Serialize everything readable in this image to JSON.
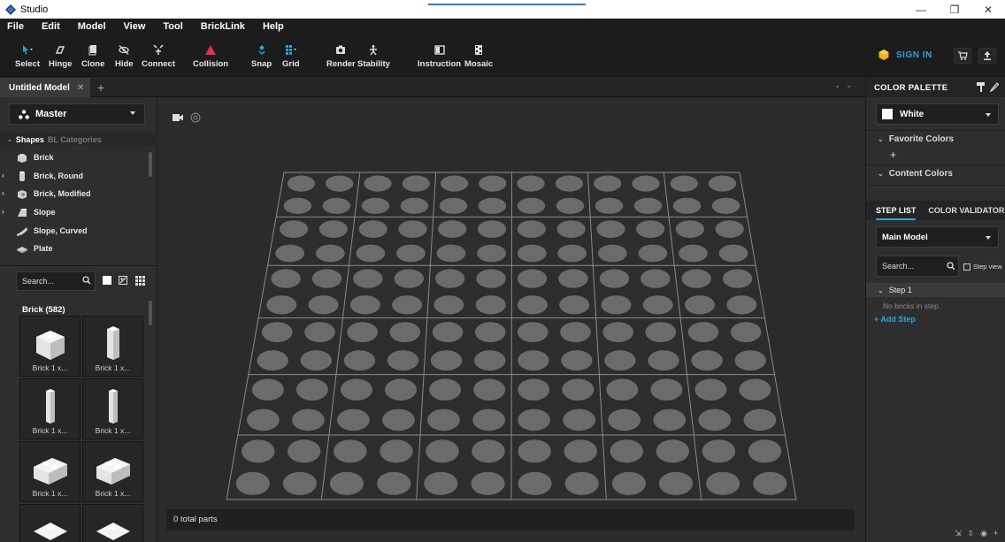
{
  "window": {
    "title": "Studio",
    "controls": [
      "—",
      "❐",
      "✕"
    ]
  },
  "menu": [
    "File",
    "Edit",
    "Model",
    "View",
    "Tool",
    "BrickLink",
    "Help"
  ],
  "toolbar": {
    "select": "Select",
    "hinge": "Hinge",
    "clone": "Clone",
    "hide": "Hide",
    "connect": "Connect",
    "collision": "Collision",
    "snap": "Snap",
    "grid": "Grid",
    "render": "Render",
    "stability": "Stability",
    "instruction": "Instruction",
    "mosaic": "Mosaic",
    "sign_in": "SIGN IN"
  },
  "tabs": {
    "model_tab": "Untitled Model",
    "close": "✕",
    "add": "+",
    "nav": "◂ ▸"
  },
  "left": {
    "palette_select": "Master",
    "shapes_tab": "Shapes",
    "categories_tab": "BL Categories",
    "categories": [
      "Brick",
      "Brick, Round",
      "Brick, Modified",
      "Slope",
      "Slope, Curved",
      "Plate"
    ],
    "search_placeholder": "Search...",
    "brick_count": "Brick (582)",
    "parts": [
      "Brick 1 x...",
      "Brick 1 x...",
      "Brick 1 x...",
      "Brick 1 x...",
      "Brick 1 x...",
      "Brick 1 x..."
    ]
  },
  "viewport": {
    "status": "0 total parts",
    "baseplate_cells": [
      6,
      6
    ],
    "studs_per_cell": [
      2,
      2
    ]
  },
  "right": {
    "color_palette_header": "COLOR PALETTE",
    "selected_color": "White",
    "favorite_colors": "Favorite Colors",
    "favorite_add": "+",
    "content_colors": "Content Colors",
    "step_list_tab": "STEP LIST",
    "color_validator_tab": "COLOR VALIDATOR",
    "model_select": "Main Model",
    "search_placeholder": "Search...",
    "step_view": "Step view",
    "step_label": "Step 1",
    "no_bricks": "No bricks in step.",
    "add_step": "+ Add Step"
  },
  "colors": {
    "accent": "#2ea3dd",
    "collision": "#e0304a",
    "sign_in_icon": "#f2b21b",
    "stud": "#6b6b6b",
    "grid_line": "#8a8a8a"
  }
}
